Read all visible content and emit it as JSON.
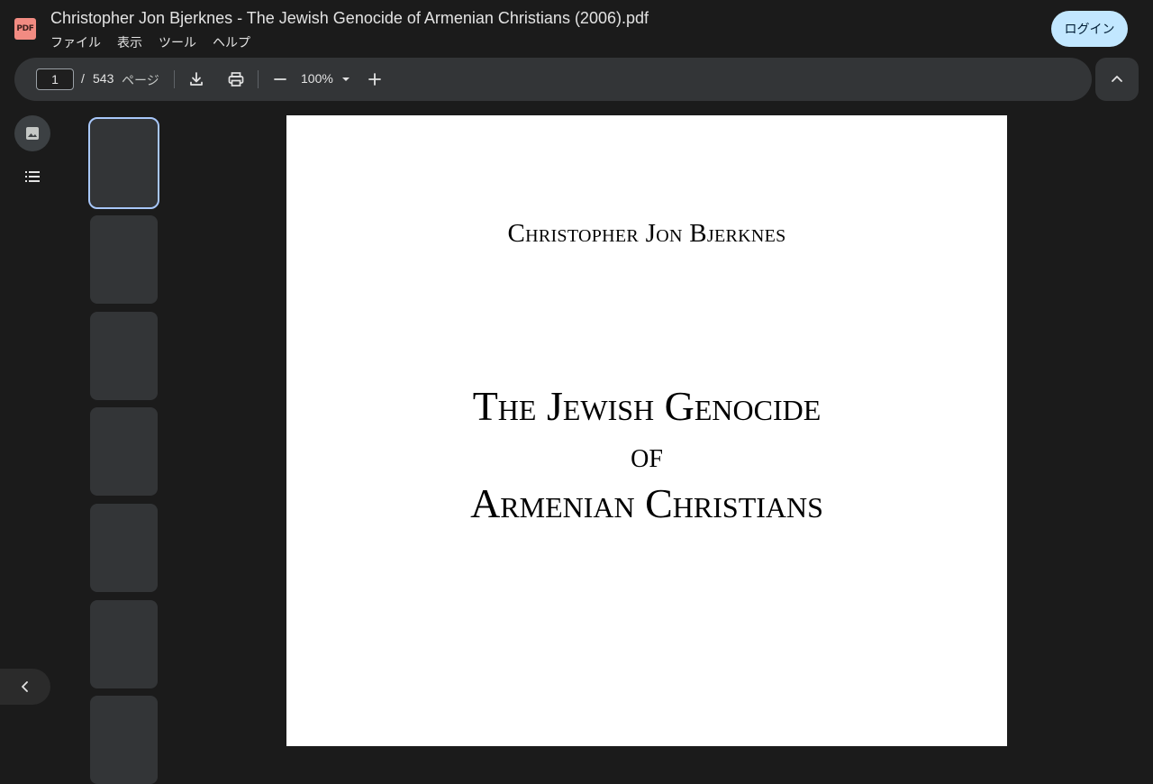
{
  "header": {
    "app_icon_label": "PDF",
    "title": "Christopher Jon Bjerknes - The Jewish Genocide of Armenian Christians (2006).pdf",
    "menu": [
      "ファイル",
      "表示",
      "ツール",
      "ヘルプ"
    ],
    "login_label": "ログイン"
  },
  "toolbar": {
    "current_page": "1",
    "separator": "/",
    "total_pages": "543",
    "page_unit": "ページ",
    "zoom": "100%"
  },
  "thumbnails": {
    "count": 7,
    "active_index": 0
  },
  "document": {
    "author": "Christopher Jon Bjerknes",
    "title_lines": [
      "The Jewish Genocide",
      "of",
      "Armenian Christians"
    ]
  },
  "colors": {
    "background": "#1b1b1b",
    "toolbar": "#333537",
    "accent": "#c2e7ff",
    "thumb_active_border": "#a8c7fa",
    "app_icon": "#f28b82"
  }
}
